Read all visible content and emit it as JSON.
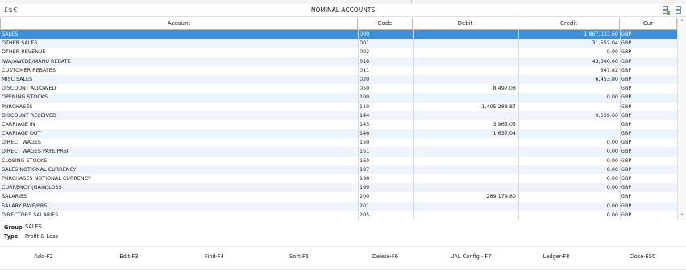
{
  "window": {
    "currency_symbols": "£$€",
    "title": "NOMINAL ACCOUNTS"
  },
  "table": {
    "columns": [
      "Account",
      "Code",
      "Debit",
      "Credit",
      "Cur"
    ],
    "rows": [
      {
        "account": "SALES",
        "code": "000",
        "debit": "",
        "credit": "1,867,033.60",
        "cur": "GBP",
        "selected": true
      },
      {
        "account": "OTHER SALES",
        "code": "001",
        "debit": "",
        "credit": "31,552.04",
        "cur": "GBP"
      },
      {
        "account": "OTHER REVENUE",
        "code": "002",
        "debit": "",
        "credit": "0.00",
        "cur": "GBP"
      },
      {
        "account": "IWA/AWEBB/MANU REBATE",
        "code": "010",
        "debit": "",
        "credit": "43,000.00",
        "cur": "GBP"
      },
      {
        "account": "CUSTOMER REBATES",
        "code": "011",
        "debit": "",
        "credit": "847.82",
        "cur": "GBP"
      },
      {
        "account": "MISC SALES",
        "code": "020",
        "debit": "",
        "credit": "6,453.80",
        "cur": "GBP"
      },
      {
        "account": "DISCOUNT ALLOWED",
        "code": "050",
        "debit": "8,497.08",
        "credit": "",
        "cur": "GBP"
      },
      {
        "account": "OPENING STOCKS",
        "code": "100",
        "debit": "",
        "credit": "0.00",
        "cur": "GBP"
      },
      {
        "account": "PURCHASES",
        "code": "110",
        "debit": "1,405,288.87",
        "credit": "",
        "cur": "GBP"
      },
      {
        "account": "DISCOUNT RECEIVED",
        "code": "144",
        "debit": "",
        "credit": "9,639.60",
        "cur": "GBP"
      },
      {
        "account": "CARRIAGE IN",
        "code": "145",
        "debit": "3,965.05",
        "credit": "",
        "cur": "GBP"
      },
      {
        "account": "CARRIAGE OUT",
        "code": "146",
        "debit": "1,637.04",
        "credit": "",
        "cur": "GBP"
      },
      {
        "account": "DIRECT WAGES",
        "code": "150",
        "debit": "",
        "credit": "0.00",
        "cur": "GBP"
      },
      {
        "account": "DIRECT WAGES PAYE/PRSI",
        "code": "151",
        "debit": "",
        "credit": "0.00",
        "cur": "GBP"
      },
      {
        "account": "CLOSING STOCKS",
        "code": "160",
        "debit": "",
        "credit": "0.00",
        "cur": "GBP"
      },
      {
        "account": "SALES NOTIONAL CURRENCY",
        "code": "197",
        "debit": "",
        "credit": "0.00",
        "cur": "GBP"
      },
      {
        "account": "PURCHASES NOTIONAL CURRENCY",
        "code": "198",
        "debit": "",
        "credit": "0.00",
        "cur": "GBP"
      },
      {
        "account": "CURRENCY (GAIN)LOSS",
        "code": "199",
        "debit": "",
        "credit": "0.00",
        "cur": "GBP"
      },
      {
        "account": "SALARIES",
        "code": "200",
        "debit": "289,179.80",
        "credit": "",
        "cur": "GBP"
      },
      {
        "account": "SALARY PAYE/PRSI",
        "code": "201",
        "debit": "",
        "credit": "0.00",
        "cur": "GBP"
      },
      {
        "account": "DIRECTORS SALARIES",
        "code": "205",
        "debit": "",
        "credit": "0.00",
        "cur": "GBP"
      }
    ]
  },
  "info": {
    "group_label": "Group",
    "group_value": "SALES",
    "type_label": "Type",
    "type_value": "Profit & Loss"
  },
  "buttons": [
    "Add-F2",
    "Edit-F3",
    "Find-F4",
    "Sort-F5",
    "Delete-F6",
    "UAL Config -  F7",
    "Ledger-F8",
    "Close-ESC"
  ],
  "icons": {
    "export": "export-icon",
    "print": "print-icon",
    "scroll_up": "chevron-up-icon",
    "scroll_down": "chevron-down-icon"
  },
  "colors": {
    "selection": "#3d8fdb",
    "alt_row": "#eef4fb"
  }
}
